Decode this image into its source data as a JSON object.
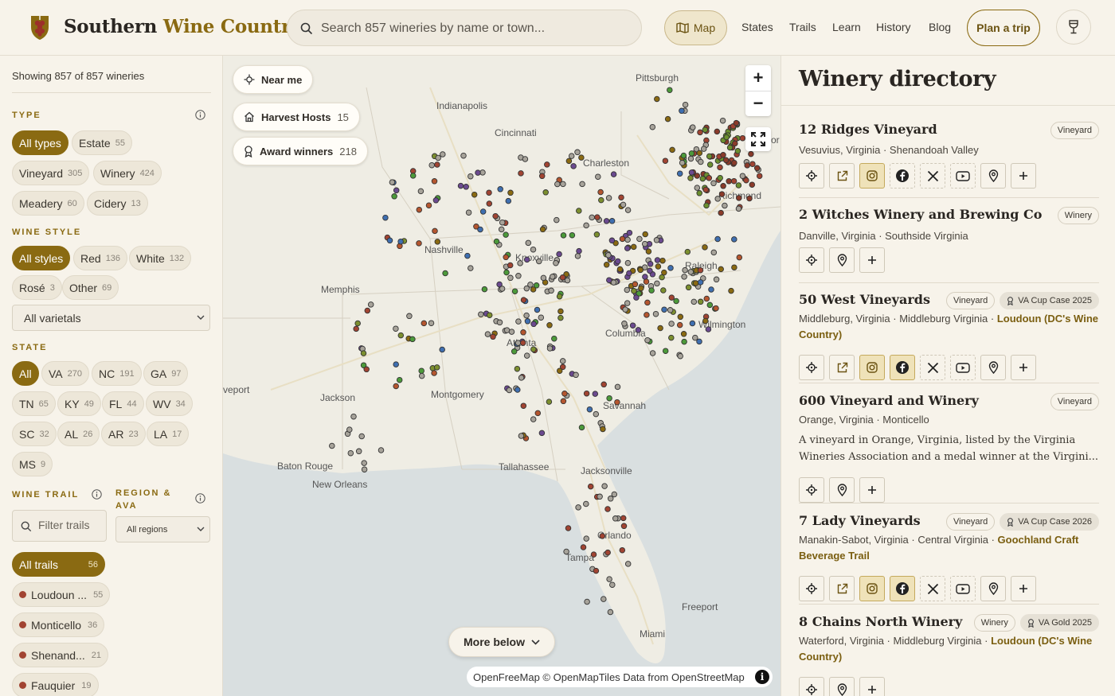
{
  "header": {
    "brand_part1": "Southern",
    "brand_part2": "Wine Country",
    "search_placeholder": "Search 857 wineries by name or town...",
    "map_label": "Map",
    "nav": [
      "States",
      "Trails",
      "Learn",
      "History",
      "Blog"
    ],
    "plan_label": "Plan a trip",
    "colors": {
      "accent": "#8a6a12",
      "background": "#f7f3ea"
    }
  },
  "sidebar": {
    "showing": "Showing 857 of 857 wineries",
    "type": {
      "label": "TYPE",
      "chips": [
        {
          "label": "All types",
          "count": ""
        },
        {
          "label": "Estate",
          "count": "55"
        },
        {
          "label": "Vineyard",
          "count": "305"
        },
        {
          "label": "Winery",
          "count": "424"
        },
        {
          "label": "Meadery",
          "count": "60"
        },
        {
          "label": "Cidery",
          "count": "13"
        }
      ]
    },
    "wine_style": {
      "label": "WINE STYLE",
      "chips": [
        {
          "label": "All styles",
          "count": ""
        },
        {
          "label": "Red",
          "count": "136"
        },
        {
          "label": "White",
          "count": "132"
        },
        {
          "label": "Rosé",
          "count": "3"
        },
        {
          "label": "Other",
          "count": "69"
        }
      ],
      "varietals_select": "All varietals"
    },
    "state": {
      "label": "STATE",
      "chips": [
        {
          "label": "All",
          "count": ""
        },
        {
          "label": "VA",
          "count": "270"
        },
        {
          "label": "NC",
          "count": "191"
        },
        {
          "label": "GA",
          "count": "97"
        },
        {
          "label": "TN",
          "count": "65"
        },
        {
          "label": "KY",
          "count": "49"
        },
        {
          "label": "FL",
          "count": "44"
        },
        {
          "label": "WV",
          "count": "34"
        },
        {
          "label": "SC",
          "count": "32"
        },
        {
          "label": "AL",
          "count": "26"
        },
        {
          "label": "AR",
          "count": "23"
        },
        {
          "label": "LA",
          "count": "17"
        },
        {
          "label": "MS",
          "count": "9"
        }
      ]
    },
    "wine_trail": {
      "label": "WINE TRAIL",
      "filter_placeholder": "Filter trails",
      "trails": [
        {
          "label": "All trails",
          "count": "56"
        },
        {
          "label": "Loudoun ...",
          "count": "55"
        },
        {
          "label": "Monticello",
          "count": "36"
        },
        {
          "label": "Shenand...",
          "count": "21"
        },
        {
          "label": "Fauquier",
          "count": "19"
        }
      ]
    },
    "region": {
      "label_line1": "REGION &",
      "label_line2": "AVA",
      "select": "All regions"
    }
  },
  "map": {
    "near_me": "Near me",
    "harvest_hosts": {
      "label": "Harvest Hosts",
      "count": "15"
    },
    "award_winners": {
      "label": "Award winners",
      "count": "218"
    },
    "zoom_in": "+",
    "zoom_out": "−",
    "more_below": "More below",
    "attribution": "OpenFreeMap © OpenMapTiles Data from OpenStreetMap",
    "cities": [
      "Pittsburgh",
      "Indianapolis",
      "Cincinnati",
      "Charleston",
      "Richmond",
      "Nashville",
      "Knoxville",
      "Raleigh",
      "Memphis",
      "Wilmington",
      "Columbia",
      "Atlanta",
      "veport",
      "Jackson",
      "Montgomery",
      "Savannah",
      "Baton Rouge",
      "New Orleans",
      "Tallahassee",
      "Jacksonville",
      "Orlando",
      "Tampa",
      "Freeport",
      "Miami",
      "or"
    ]
  },
  "directory": {
    "title": "Winery directory",
    "cards": [
      {
        "name": "12 Ridges Vineyard",
        "badges": [
          "Vineyard"
        ],
        "award": "",
        "location": "Vesuvius, Virginia · Shenandoah Valley",
        "trail": "",
        "description": ""
      },
      {
        "name": "2 Witches Winery and Brewing Co",
        "badges": [
          "Winery"
        ],
        "award": "",
        "location": "Danville, Virginia · Southside Virginia",
        "trail": "",
        "description": ""
      },
      {
        "name": "50 West Vineyards",
        "badges": [
          "Vineyard"
        ],
        "award": "VA Cup Case 2025",
        "location": "Middleburg, Virginia · Middleburg Virginia · ",
        "trail": "Loudoun (DC's Wine Country)",
        "description": ""
      },
      {
        "name": "600 Vineyard and Winery",
        "badges": [
          "Vineyard"
        ],
        "award": "",
        "location": "Orange, Virginia · Monticello",
        "trail": "",
        "description": "A vineyard in Orange, Virginia, listed by the Virginia Wineries Association and a medal winner at the Virgini..."
      },
      {
        "name": "7 Lady Vineyards",
        "badges": [
          "Vineyard"
        ],
        "award": "VA Cup Case 2026",
        "location": "Manakin-Sabot, Virginia · Central Virginia · ",
        "trail": "Goochland Craft Beverage Trail",
        "description": ""
      },
      {
        "name": "8 Chains North Winery",
        "badges": [
          "Winery"
        ],
        "award": "VA Gold 2025",
        "location": "Waterford, Virginia · Middleburg Virginia · ",
        "trail": "Loudoun (DC's Wine Country)",
        "description": ""
      }
    ]
  }
}
